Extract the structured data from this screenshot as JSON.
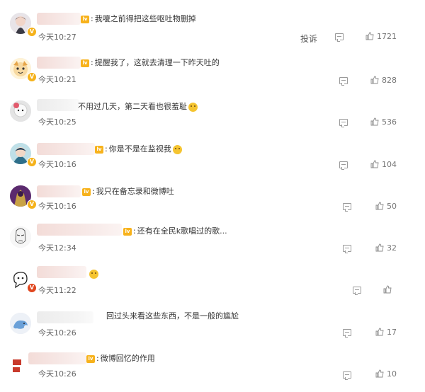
{
  "comments": [
    {
      "text": "我嗄之前得把这些呕吐物删掉",
      "time": "今天10:27",
      "likes": "1721",
      "report": "投诉"
    },
    {
      "text": "提醒我了，这就去清理一下昨天吐的",
      "time": "今天10:21",
      "likes": "828"
    },
    {
      "text": "不用过几天，第二天看也很羞耻",
      "time": "今天10:25",
      "likes": "536"
    },
    {
      "text": "你是不是在监视我",
      "time": "今天10:16",
      "likes": "104"
    },
    {
      "text": "我只在备忘录和微博吐",
      "time": "今天10:16",
      "likes": "50"
    },
    {
      "text": "还有在全民k歌唱过的歌...",
      "time": "今天12:34",
      "likes": "32"
    },
    {
      "text": "",
      "time": "今天11:22",
      "likes": ""
    },
    {
      "text": "回过头来看这些东西，不是一般的尴尬",
      "time": "今天10:26",
      "likes": "17"
    },
    {
      "text": "微博回忆的作用",
      "time": "今天10:26",
      "likes": "10"
    }
  ],
  "icons": {
    "reply": "comment-icon",
    "like": "thumbs-up-icon",
    "verified": "verified-badge-icon",
    "level": "level-badge-icon"
  },
  "colors": {
    "level_badge": "#f7b21c",
    "verified_badge": "#f5b21b",
    "red_badge": "#e0461e"
  }
}
